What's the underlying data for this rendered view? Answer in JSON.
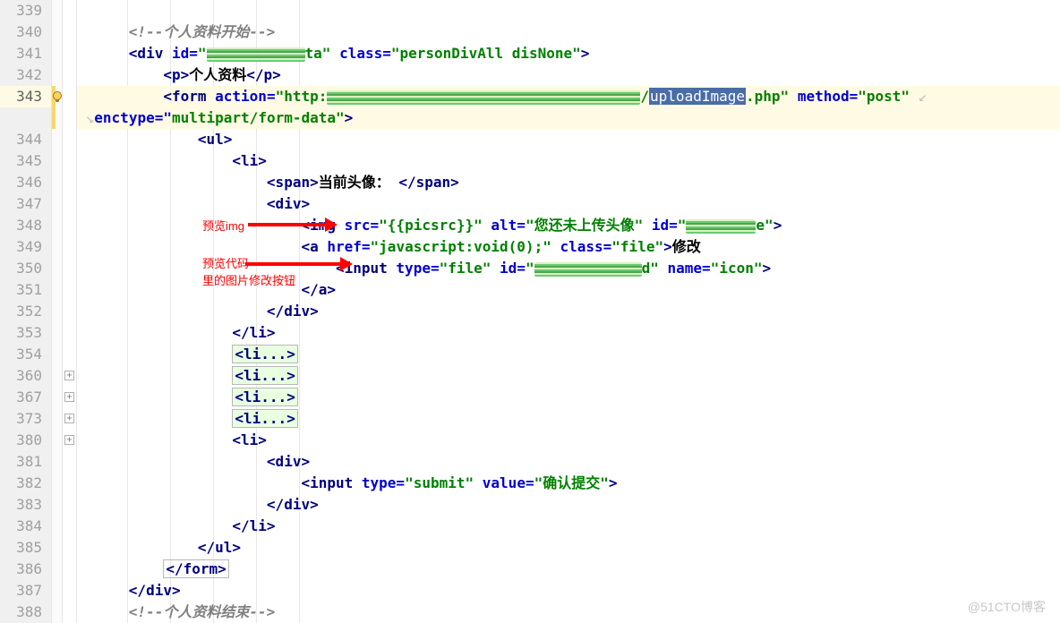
{
  "gutter_numbers": [
    "339",
    "340",
    "341",
    "342",
    "343",
    "",
    "344",
    "345",
    "346",
    "347",
    "348",
    "349",
    "350",
    "351",
    "352",
    "353",
    "354",
    "360",
    "367",
    "373",
    "380",
    "381",
    "382",
    "383",
    "384",
    "385",
    "386",
    "387",
    "388"
  ],
  "current_line_index": 4,
  "comment_start": "<!--个人资料开始-->",
  "comment_end": "<!--个人资料结束-->",
  "div_open_prefix": "<div id=\"",
  "div_open_id_obscured": "██████ ██ta",
  "div_open_mid": "\" class=\"",
  "div_class_val": "personDivAll disNone",
  "div_open_end": "\">",
  "p_open": "<p>",
  "p_text": "个人资料",
  "p_close": "</p>",
  "form_open": "<form action=\"",
  "form_action_prefix": "http:",
  "form_action_obscured": "████████████████████",
  "form_action_slash": "/",
  "form_action_selected": "uploadImage",
  "form_action_suffix": ".php",
  "form_mid": "\" method=\"",
  "form_method": "post",
  "form_mid2": "\" ",
  "enctype_label": "enctype=\"",
  "enctype_val": "multipart/form-data",
  "enctype_end": "\">",
  "ul_open": "<ul>",
  "ul_close": "</ul>",
  "li_open": "<li>",
  "li_close": "</li>",
  "li_fold": "<li...>",
  "span_open": "<span>",
  "span_text": "当前头像：",
  "span_close": "</span>",
  "div2_open": "<div>",
  "div2_close": "</div>",
  "img_open": "<img src=\"",
  "img_src": "{{picsrc}}",
  "img_mid": "\" alt=\"",
  "img_alt": "您还未上传头像",
  "img_mid2": "\" id=\"",
  "img_id_obscured": "██ ██ █e",
  "img_end": "\">",
  "a_open": "<a href=\"",
  "a_href": "javascript:void(0);",
  "a_mid": "\" class=\"",
  "a_class": "file",
  "a_end": "\">",
  "a_text": "修改",
  "a_close": "</a>",
  "input_open": "<input type=\"",
  "input_type_file": "file",
  "input_mid": "\" id=\"",
  "input_id_obscured": "██ ███████d",
  "input_mid2": "\" name=\"",
  "input_name": "icon",
  "input_end": "\">",
  "input_type_submit": "submit",
  "input_sub_mid": "\" value=\"",
  "input_sub_val": "确认提交",
  "form_close": "</form>",
  "div_close": "</div>",
  "annot1": "预览img",
  "annot2_l1": "预览代码",
  "annot2_l2": "里的图片修改按钮",
  "watermark": "@51CTO博客",
  "fold_plus": "+"
}
